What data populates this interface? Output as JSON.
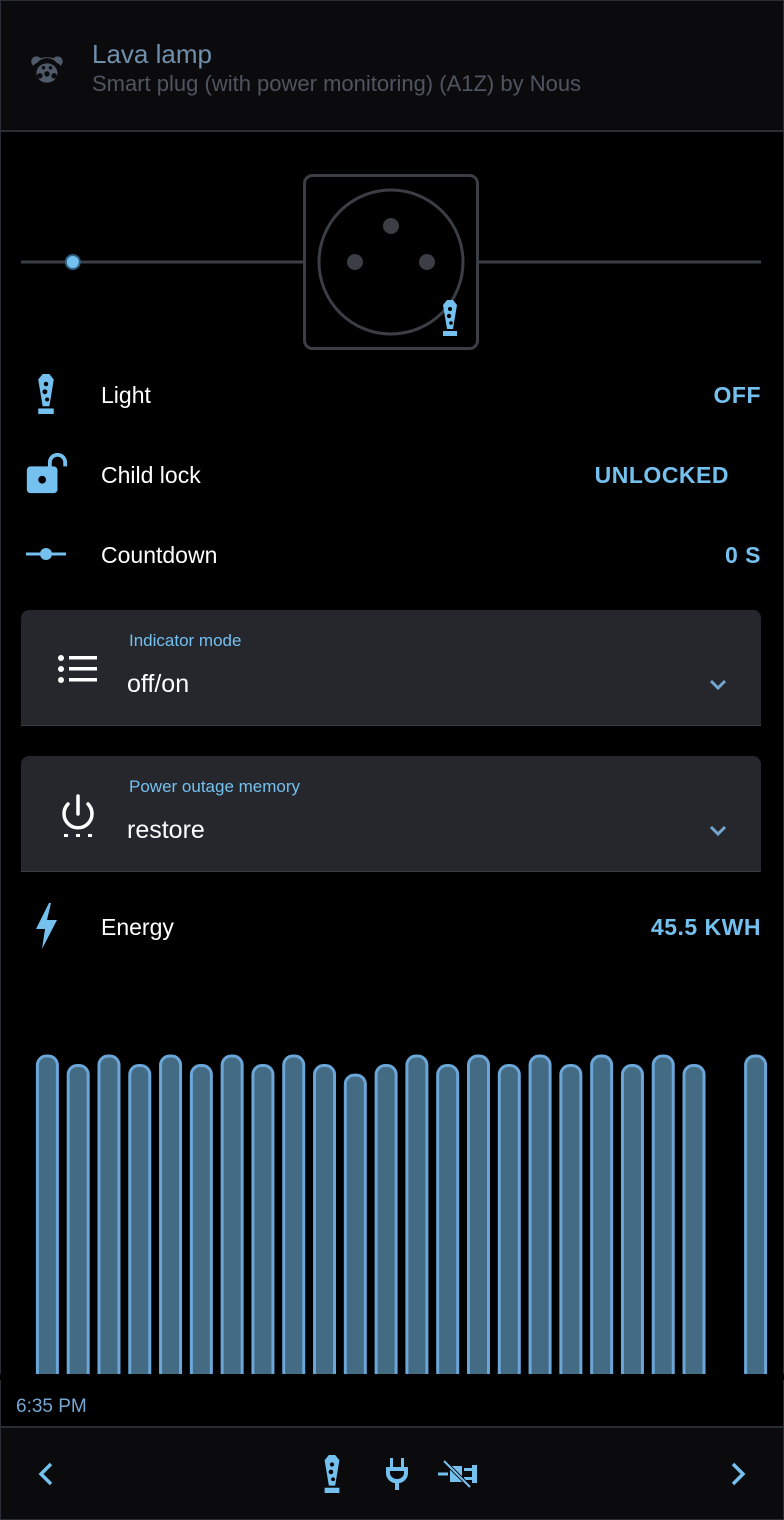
{
  "header": {
    "title": "Lava lamp",
    "subtitle": "Smart plug (with power monitoring) (A1Z) by Nous",
    "icon": "teddy-bear-icon"
  },
  "socket": {
    "slider_position": 0.07
  },
  "rows": {
    "light": {
      "label": "Light",
      "value": "OFF",
      "icon": "lava-lamp-icon"
    },
    "child_lock": {
      "label": "Child lock",
      "value": "UNLOCKED",
      "icon": "lock-open-icon"
    },
    "countdown": {
      "label": "Countdown",
      "value": "0 S",
      "icon": "slider-icon"
    },
    "energy": {
      "label": "Energy",
      "value": "45.5 KWH",
      "icon": "lightning-bolt-icon"
    }
  },
  "selects": {
    "indicator_mode": {
      "label": "Indicator mode",
      "value": "off/on",
      "icon": "list-icon"
    },
    "power_outage_memory": {
      "label": "Power outage memory",
      "value": "restore",
      "icon": "power-icon"
    }
  },
  "chart_data": {
    "type": "bar",
    "values": [
      1.0,
      0.97,
      1.0,
      0.97,
      1.0,
      0.97,
      1.0,
      0.97,
      1.0,
      0.97,
      0.94,
      0.97,
      1.0,
      0.97,
      1.0,
      0.97,
      1.0,
      0.97,
      1.0,
      0.97,
      1.0,
      0.97,
      null,
      1.0
    ],
    "x_end_label": "6:35 PM",
    "colors": {
      "fill": "#446b84",
      "stroke": "#6aa6d8"
    }
  },
  "time_label": "6:35 PM",
  "bottom": {
    "prev_icon": "chevron-left-icon",
    "next_icon": "chevron-right-icon",
    "icons": [
      "lava-lamp-icon",
      "power-plug-icon",
      "power-plug-off-icon"
    ]
  },
  "colors": {
    "accent": "#74c0ee",
    "background": "#000000",
    "card": "#25272d"
  }
}
